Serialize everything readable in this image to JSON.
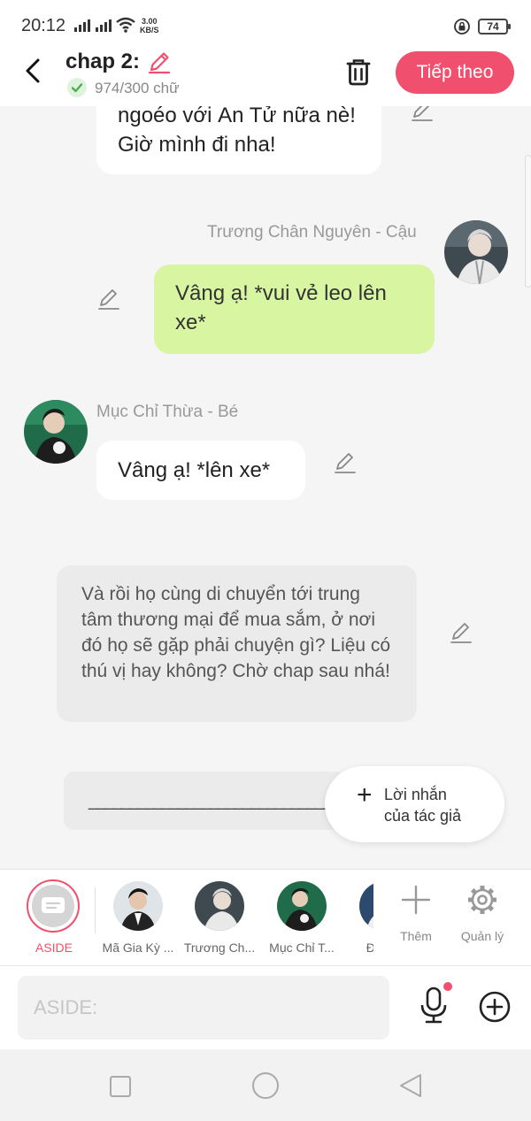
{
  "status_bar": {
    "time": "20:12",
    "net_speed_value": "3.00",
    "net_speed_unit": "KB/S",
    "battery": "74"
  },
  "header": {
    "chapter_title": "chap 2:",
    "word_count": "974/300 chữ",
    "next_label": "Tiếp theo"
  },
  "messages": [
    {
      "type": "narration-white",
      "text": "ngoéo với Ăn Tử nữa nè! Giờ mình đi nha!"
    },
    {
      "type": "right",
      "sender": "Trương Chân Nguyên - Cậu",
      "text": "Vâng ạ! *vui vẻ leo lên xe*"
    },
    {
      "type": "left",
      "sender": "Mục Chỉ Thừa - Bé",
      "text": "Vâng ạ! *lên xe*"
    },
    {
      "type": "aside",
      "text": "Và rồi họ cùng di chuyển tới trung tâm thương mại để mua sắm, ở nơi đó họ sẽ gặp phải chuyện gì? Liệu có thú vị hay không? Chờ chap sau nhá!"
    },
    {
      "type": "divider",
      "text": "______________________________"
    }
  ],
  "author_note": {
    "label_line1": "Lời nhắn",
    "label_line2": "của tác giả"
  },
  "character_bar": {
    "aside_label": "ASIDE",
    "characters": [
      {
        "name": "Mã Gia Kỳ ..."
      },
      {
        "name": "Trương Ch..."
      },
      {
        "name": "Mục Chỉ T..."
      },
      {
        "name": "Đinh..."
      }
    ],
    "add_label": "Thêm",
    "manage_label": "Quản lý"
  },
  "input": {
    "placeholder": "ASIDE:"
  },
  "colors": {
    "accent": "#f0506e",
    "green_bubble": "#d8f5a2",
    "check_green": "#4caf50"
  }
}
